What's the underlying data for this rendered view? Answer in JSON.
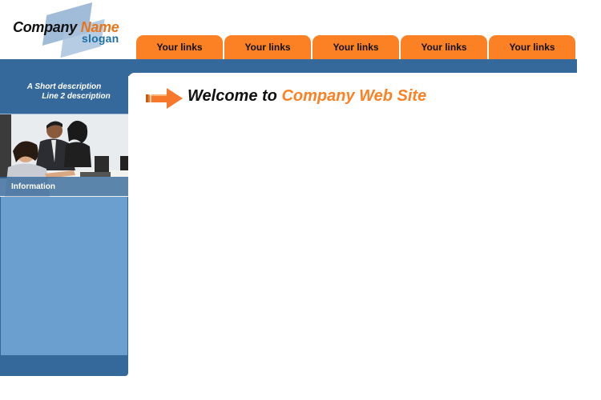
{
  "logo": {
    "company": "Company",
    "name": "Name",
    "slogan": "slogan"
  },
  "nav": {
    "tabs": [
      {
        "label": "Your links"
      },
      {
        "label": "Your links"
      },
      {
        "label": "Your links"
      },
      {
        "label": "Your links"
      },
      {
        "label": "Your links"
      }
    ]
  },
  "sidebar": {
    "description_line1": "A Short description",
    "description_line2": "Line 2 description",
    "information_label": "Information"
  },
  "main": {
    "welcome_prefix": "Welcome to",
    "welcome_accent": "Company Web Site"
  },
  "colors": {
    "orange": "#fb8124",
    "blue": "#36699b",
    "light_blue": "#6b9fcf"
  }
}
